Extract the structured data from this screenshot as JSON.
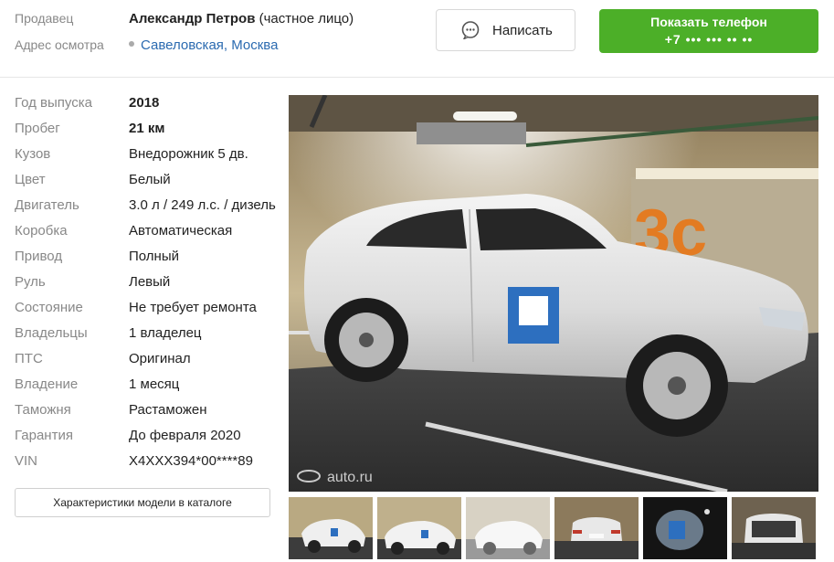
{
  "seller": {
    "seller_label": "Продавец",
    "name": "Александр Петров",
    "type": "(частное лицо)",
    "address_label": "Адрес осмотра",
    "address": "Савеловская, Москва"
  },
  "actions": {
    "write_label": "Написать",
    "phone_label": "Показать телефон",
    "phone_masked": "+7 ••• ••• •• ••"
  },
  "specs": [
    {
      "key": "Год выпуска",
      "value": "2018",
      "bold": true
    },
    {
      "key": "Пробег",
      "value": "21 км",
      "bold": true
    },
    {
      "key": "Кузов",
      "value": "Внедорожник 5 дв."
    },
    {
      "key": "Цвет",
      "value": "Белый"
    },
    {
      "key": "Двигатель",
      "value": "3.0 л / 249 л.с. / дизель"
    },
    {
      "key": "Коробка",
      "value": "Автоматическая"
    },
    {
      "key": "Привод",
      "value": "Полный"
    },
    {
      "key": "Руль",
      "value": "Левый"
    },
    {
      "key": "Состояние",
      "value": "Не требует ремонта"
    },
    {
      "key": "Владельцы",
      "value": "1 владелец"
    },
    {
      "key": "ПТС",
      "value": "Оригинал"
    },
    {
      "key": "Владение",
      "value": "1 месяц"
    },
    {
      "key": "Таможня",
      "value": "Растаможен"
    },
    {
      "key": "Гарантия",
      "value": "До февраля 2020"
    },
    {
      "key": "VIN",
      "value": "X4XXX394*00****89"
    }
  ],
  "catalog_button": "Характеристики модели в каталоге",
  "photo": {
    "watermark": "auto.ru",
    "garage_sign": "3c"
  },
  "thumbnails": [
    {
      "name": "thumb-1"
    },
    {
      "name": "thumb-2"
    },
    {
      "name": "thumb-3"
    },
    {
      "name": "thumb-4"
    },
    {
      "name": "thumb-5"
    },
    {
      "name": "thumb-6"
    }
  ],
  "colors": {
    "accent_green": "#4caf28",
    "link_blue": "#2a6ab0",
    "label_gray": "#888888"
  }
}
